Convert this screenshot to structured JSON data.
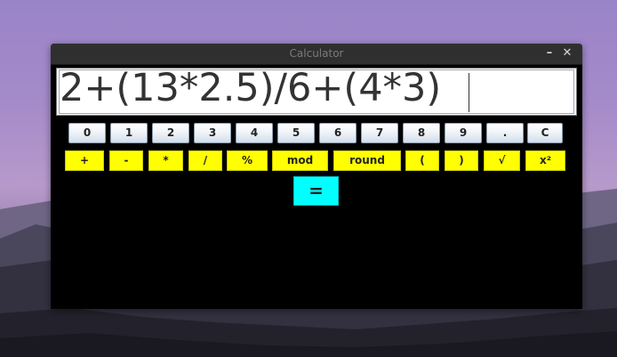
{
  "window": {
    "title": "Calculator",
    "minimize_glyph": "–",
    "close_glyph": "✕"
  },
  "display": {
    "expression": "2+(13*2.5)/6+(4*3)"
  },
  "digit_row": [
    "0",
    "1",
    "2",
    "3",
    "4",
    "5",
    "6",
    "7",
    "8",
    "9",
    ".",
    "C"
  ],
  "operator_row": [
    "+",
    "-",
    "*",
    "/",
    "%",
    "mod",
    "round",
    "(",
    ")",
    "√",
    "x²"
  ],
  "equals_label": "=",
  "colors": {
    "operator_bg": "#ffff00",
    "equals_bg": "#00ffff",
    "window_bg": "#000000",
    "display_bg": "#ffffff"
  }
}
